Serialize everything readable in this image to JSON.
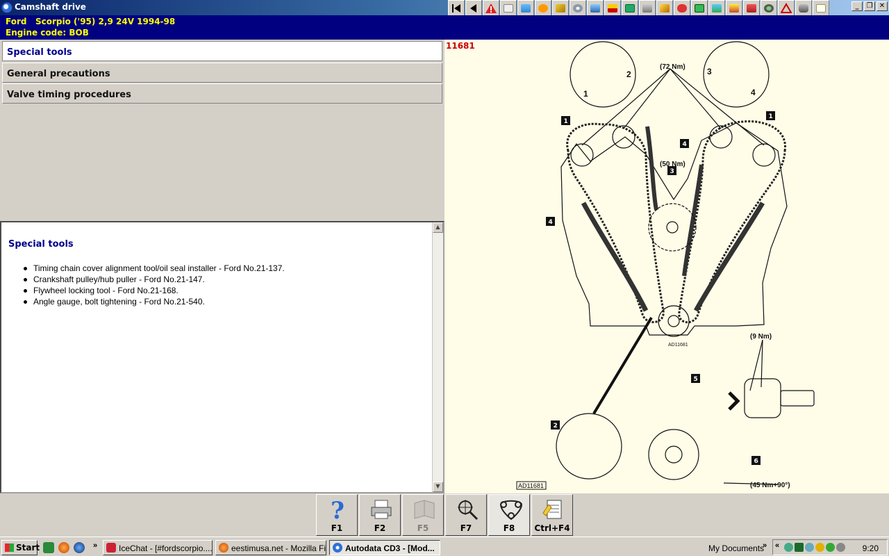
{
  "window": {
    "title": "Camshaft drive"
  },
  "toolbar": {
    "buttons": [
      "first-page-icon",
      "back-icon",
      "warning-icon",
      "blank-icon",
      "image-icon",
      "gear-icon",
      "wrench-icon",
      "disc-icon",
      "tools-icon",
      "gauge-icon",
      "save-icon",
      "print-icon",
      "key-icon",
      "car-icon",
      "monitor-icon",
      "network-icon",
      "info-icon",
      "bug-icon",
      "sensor-icon",
      "triangle-icon",
      "car-data-icon",
      "notes-icon"
    ]
  },
  "vehicle": {
    "line1": "Ford   Scorpio ('95) 2,9 24V 1994-98",
    "line2": "Engine code: BOB"
  },
  "nav": {
    "items": [
      {
        "label": "Special tools",
        "active": true
      },
      {
        "label": "General precautions",
        "active": false
      },
      {
        "label": "Valve timing procedures",
        "active": false
      }
    ]
  },
  "content": {
    "title": "Special tools",
    "items": [
      "Timing chain cover alignment tool/oil seal installer - Ford No.21-137.",
      "Crankshaft pulley/hub puller - Ford No.21-147.",
      "Flywheel locking tool - Ford No.21-168.",
      "Angle gauge, bolt tightening - Ford No.21-540."
    ]
  },
  "diagram": {
    "id": "11681",
    "torque_72": "(72 Nm)",
    "torque_50": "(50 Nm)",
    "torque_9": "(9 Nm)",
    "torque_45": "(45 Nm+90°)",
    "ref_main": "AD11681",
    "ref_small": "AD11681",
    "callouts": [
      "1",
      "1",
      "2",
      "3",
      "4",
      "4",
      "5",
      "6"
    ],
    "inset_numbers": [
      "1",
      "2",
      "3",
      "4"
    ]
  },
  "fkeys": [
    {
      "label": "F1",
      "icon": "help-icon",
      "enabled": true
    },
    {
      "label": "F2",
      "icon": "printer-icon",
      "enabled": true
    },
    {
      "label": "F5",
      "icon": "book-icon",
      "enabled": false
    },
    {
      "label": "F7",
      "icon": "magnifier-icon",
      "enabled": true
    },
    {
      "label": "F8",
      "icon": "timing-belt-icon",
      "enabled": true
    },
    {
      "label": "Ctrl+F4",
      "icon": "notes-icon",
      "enabled": true
    }
  ],
  "taskbar": {
    "start": "Start",
    "tasks": [
      {
        "label": "IceChat - [#fordscorpio....",
        "active": false
      },
      {
        "label": "eestimusa.net - Mozilla Fi...",
        "active": false
      },
      {
        "label": "Autodata CD3 - [Mod...",
        "active": true
      }
    ],
    "mydocs": "My Documents",
    "clock": "9:20"
  }
}
